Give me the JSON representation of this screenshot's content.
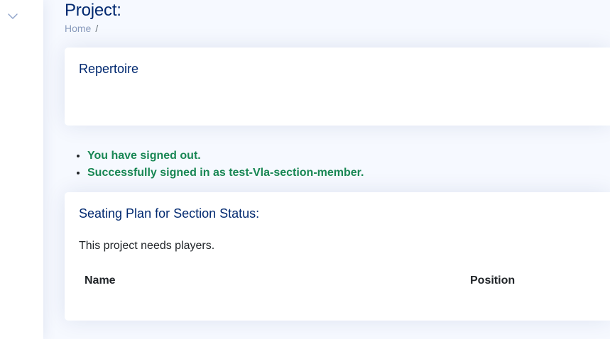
{
  "sidebar": {
    "toggle_icon": "chevron-down-icon"
  },
  "header": {
    "title": "Project:",
    "breadcrumb": [
      {
        "label": "Home"
      }
    ],
    "breadcrumb_separator": "/"
  },
  "repertoire": {
    "title": "Repertoire"
  },
  "messages": [
    "You have signed out.",
    "Successfully signed in as test-Vla-section-member."
  ],
  "seating": {
    "title": "Seating Plan for Section Status:",
    "empty_text": "This project needs players.",
    "columns": [
      "Name",
      "Position"
    ]
  },
  "colors": {
    "title": "#012970",
    "breadcrumb": "#899bbd",
    "success": "#198754",
    "background": "#f6f9ff"
  }
}
